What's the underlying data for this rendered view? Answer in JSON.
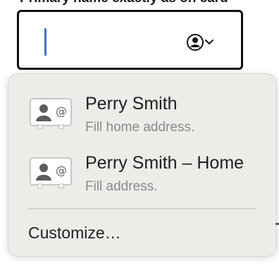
{
  "form": {
    "field_label": "Primary name exactly as on card"
  },
  "autofill_menu": {
    "suggestions": [
      {
        "name": "Perry Smith",
        "detail": "Fill home address.",
        "icon": "contact-card-icon"
      },
      {
        "name": "Perry Smith – Home",
        "detail": "Fill address.",
        "icon": "contact-card-icon"
      }
    ],
    "customize_label": "Customize…"
  },
  "colors": {
    "caret": "#3a74e0",
    "popup_background": "#ececE9",
    "primary_text": "#1f1f1f",
    "secondary_text": "#8a8a8a"
  }
}
